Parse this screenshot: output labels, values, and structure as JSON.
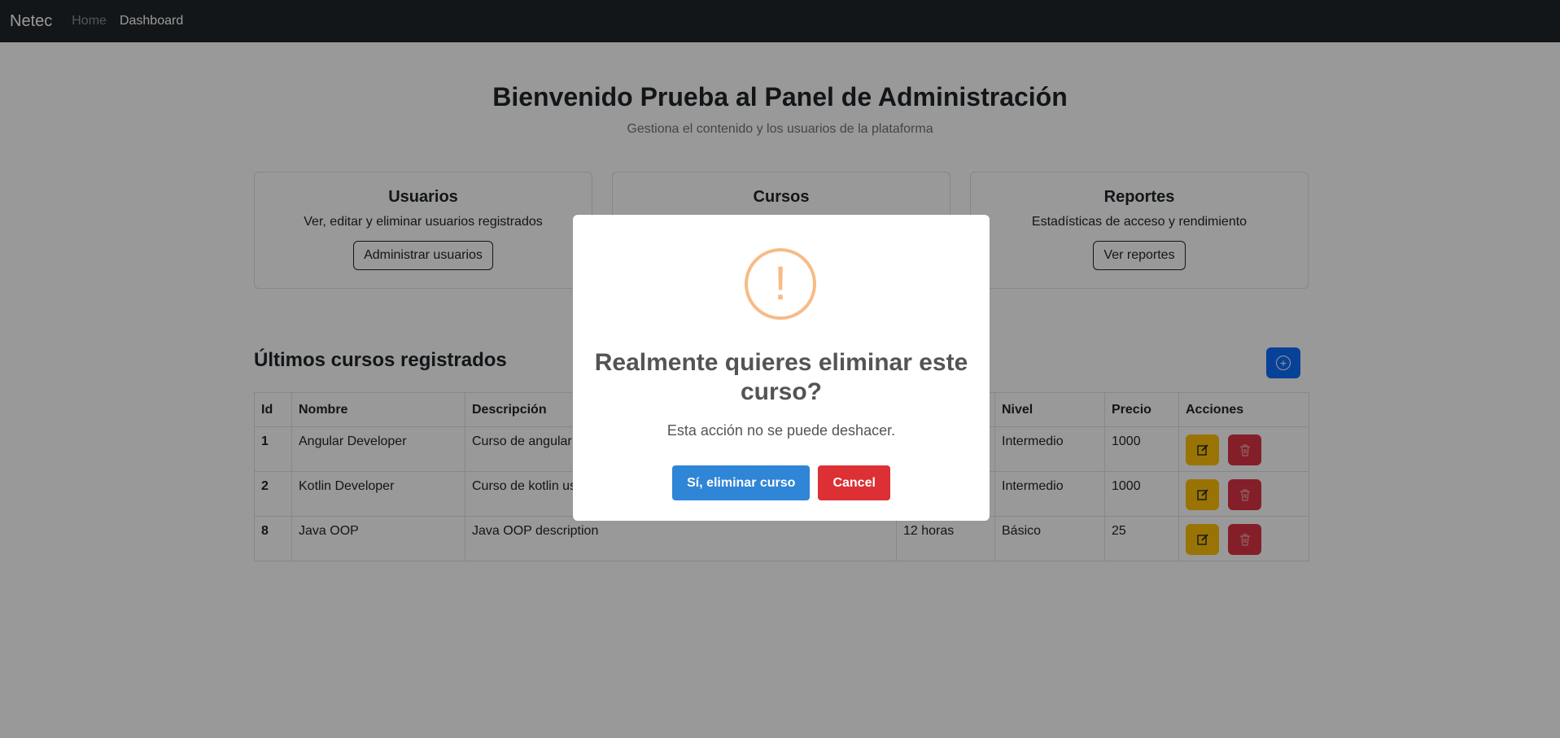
{
  "navbar": {
    "brand": "Netec",
    "links": [
      "Home",
      "Dashboard"
    ]
  },
  "header": {
    "title": "Bienvenido Prueba al Panel de Administración",
    "subtitle": "Gestiona el contenido y los usuarios de la plataforma"
  },
  "cards": [
    {
      "title": "Usuarios",
      "text": "Ver, editar y eliminar usuarios registrados",
      "button": "Administrar usuarios"
    },
    {
      "title": "Cursos",
      "text": "",
      "button": ""
    },
    {
      "title": "Reportes",
      "text": "Estadísticas de acceso y rendimiento",
      "button": "Ver reportes"
    }
  ],
  "section": {
    "title": "Últimos cursos registrados",
    "add_icon": "plus-circle-icon"
  },
  "table": {
    "headers": [
      "Id",
      "Nombre",
      "Descripción",
      "",
      "Nivel",
      "Precio",
      "Acciones"
    ],
    "rows": [
      {
        "id": "1",
        "nombre": "Angular Developer",
        "descripcion": "Curso de angular",
        "duracion": "",
        "nivel": "Intermedio",
        "precio": "1000"
      },
      {
        "id": "2",
        "nombre": "Kotlin Developer",
        "descripcion": "Curso de kotlin us",
        "duracion": "",
        "nivel": "Intermedio",
        "precio": "1000"
      },
      {
        "id": "8",
        "nombre": "Java OOP",
        "descripcion": "Java OOP description",
        "duracion": "12 horas",
        "nivel": "Básico",
        "precio": "25"
      }
    ]
  },
  "modal": {
    "icon": "!",
    "title": "Realmente quieres eliminar este curso?",
    "text": "Esta acción no se puede deshacer.",
    "confirm_label": "Sí, eliminar curso",
    "cancel_label": "Cancel"
  },
  "colors": {
    "navbar": "#212529",
    "primary": "#0d6efd",
    "warning": "#ffc107",
    "danger": "#dc3545",
    "modal_icon": "#f8bb86",
    "confirm": "#2f85d6",
    "cancel": "#dc3035"
  }
}
